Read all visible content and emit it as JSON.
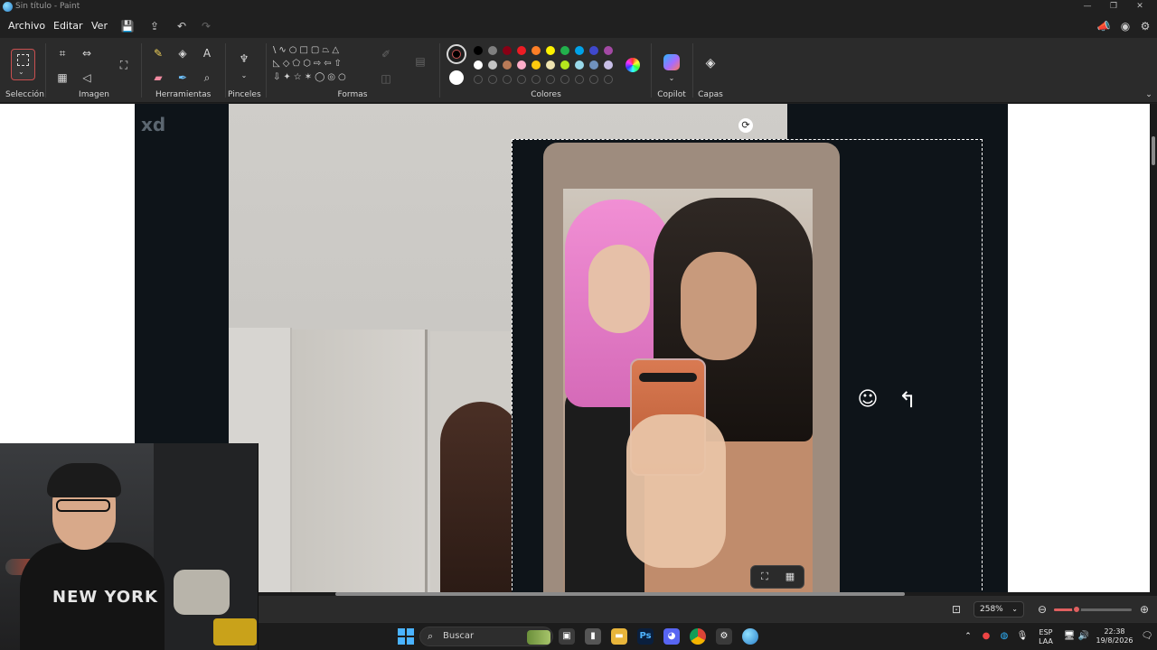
{
  "window": {
    "title": "Sin título - Paint"
  },
  "menu": {
    "items": [
      "Archivo",
      "Editar",
      "Ver"
    ]
  },
  "ribbon": {
    "groups": {
      "selection": "Selección",
      "image": "Imagen",
      "tools": "Herramientas",
      "brushes": "Pinceles",
      "shapes": "Formas",
      "colors": "Colores",
      "copilot": "Copilot",
      "layers": "Capas"
    },
    "palette_row1": [
      "#000000",
      "#7f7f7f",
      "#880015",
      "#ed1c24",
      "#ff7f27",
      "#fff200",
      "#22b14c",
      "#00a2e8",
      "#3f48cc",
      "#a349a4"
    ],
    "palette_row2": [
      "#ffffff",
      "#c3c3c3",
      "#b97a57",
      "#ffaec9",
      "#ffc90e",
      "#efe4b0",
      "#b5e61d",
      "#99d9ea",
      "#7092be",
      "#c8bfe7"
    ]
  },
  "canvas": {
    "overlay_text": "xd"
  },
  "statusbar": {
    "zoom": "258%",
    "zoom_fraction": 0.29
  },
  "taskbar": {
    "search_placeholder": "Buscar",
    "lang_line1": "ESP",
    "lang_line2": "LAA",
    "time": "22:38",
    "date": "19/8/2026"
  }
}
